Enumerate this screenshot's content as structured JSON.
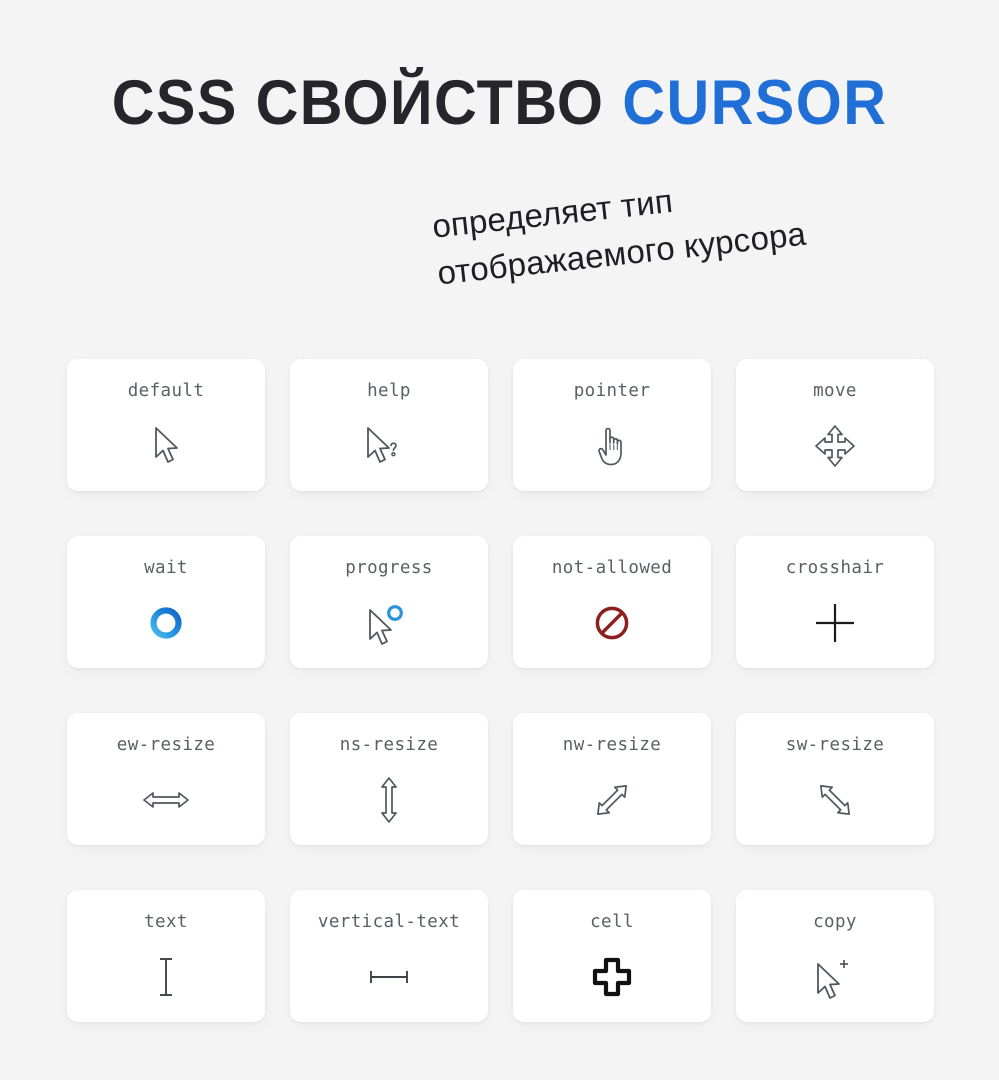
{
  "header": {
    "title_prefix": "CSS СВОЙСТВО",
    "title_accent": "CURSOR",
    "accent_color": "#1f6fd6",
    "text_color": "#26262a"
  },
  "subtitle": {
    "line1": "определяет тип",
    "line2": "отображаемого курсора"
  },
  "background_color": "#f4f4f4",
  "card_background": "#ffffff",
  "label_color": "#5a5f66",
  "cards": [
    {
      "label": "default",
      "icon": "arrow-cursor-icon"
    },
    {
      "label": "help",
      "icon": "arrow-cursor-question-icon"
    },
    {
      "label": "pointer",
      "icon": "pointing-hand-icon"
    },
    {
      "label": "move",
      "icon": "four-way-arrow-icon"
    },
    {
      "label": "wait",
      "icon": "blue-ring-spinner-icon"
    },
    {
      "label": "progress",
      "icon": "arrow-cursor-ring-icon"
    },
    {
      "label": "not-allowed",
      "icon": "no-entry-icon"
    },
    {
      "label": "crosshair",
      "icon": "plus-crosshair-icon"
    },
    {
      "label": "ew-resize",
      "icon": "horizontal-double-arrow-icon"
    },
    {
      "label": "ns-resize",
      "icon": "vertical-double-arrow-icon"
    },
    {
      "label": "nw-resize",
      "icon": "diagonal-nwse-double-arrow-icon"
    },
    {
      "label": "sw-resize",
      "icon": "diagonal-swne-double-arrow-icon"
    },
    {
      "label": "text",
      "icon": "vertical-i-beam-icon"
    },
    {
      "label": "vertical-text",
      "icon": "horizontal-i-beam-icon"
    },
    {
      "label": "cell",
      "icon": "thick-plus-icon"
    },
    {
      "label": "copy",
      "icon": "arrow-cursor-plus-icon"
    }
  ],
  "icon_colors": {
    "cursor_outline": "#4a4f57",
    "spinner_blue_light": "#3fb3ea",
    "spinner_blue_dark": "#1876d1",
    "not_allowed_red": "#8d1f1f",
    "crosshair_black": "#1a1a1a",
    "cell_black": "#111111"
  }
}
